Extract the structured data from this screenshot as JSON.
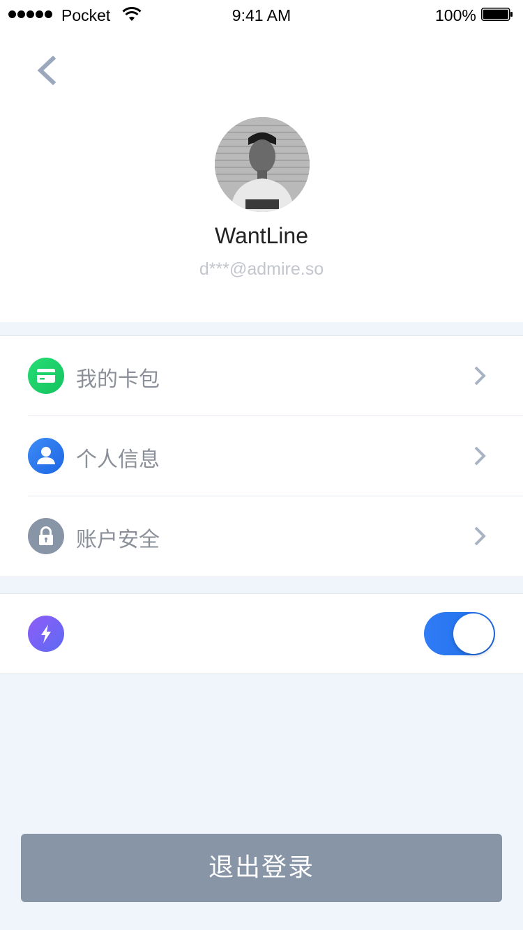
{
  "status_bar": {
    "carrier": "Pocket",
    "time": "9:41 AM",
    "battery_percent": "100%",
    "battery_level": 1.0,
    "icons": [
      "signal-dots-icon",
      "wifi-icon",
      "battery-icon"
    ]
  },
  "header": {
    "back_icon": "chevron-left-icon",
    "avatar": "user-avatar-photo",
    "username": "WantLine",
    "email": "d***@admire.so"
  },
  "menu": {
    "items": [
      {
        "label": "我的卡包",
        "icon": "card-icon",
        "icon_color": "#1fd26a"
      },
      {
        "label": "个人信息",
        "icon": "person-icon",
        "icon_color": "#2a7af3"
      },
      {
        "label": "账户安全",
        "icon": "lock-icon",
        "icon_color": "#8895a7"
      }
    ],
    "chevron_icon": "chevron-right-icon"
  },
  "toggle": {
    "icon": "lightning-icon",
    "icon_color": "#7b5cf5",
    "on": true
  },
  "logout": {
    "label": "退出登录",
    "color": "#8895a7"
  },
  "colors": {
    "background": "#f0f4fb",
    "accent": "#2f7cf6",
    "divider": "#e3e7ee"
  }
}
